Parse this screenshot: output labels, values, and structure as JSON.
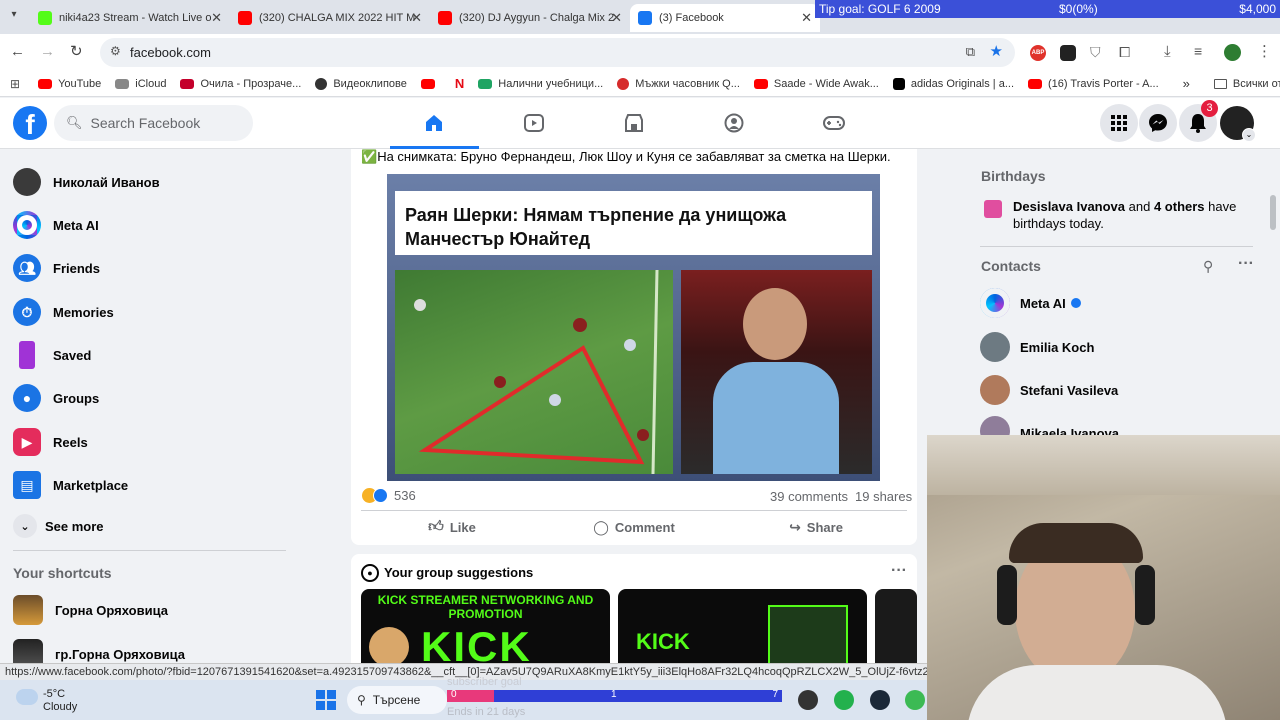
{
  "browser": {
    "tabs": [
      {
        "title": "niki4a23 Stream - Watch Live o",
        "icon": "kick-icon",
        "color": "#53fc18"
      },
      {
        "title": "(320) CHALGA MIX 2022 HIT M",
        "icon": "youtube-icon",
        "color": "#ff0000"
      },
      {
        "title": "(320) DJ Aygyun - Chalga Mix 2",
        "icon": "youtube-icon",
        "color": "#ff0000"
      },
      {
        "title": "(3) Facebook",
        "icon": "facebook-icon",
        "color": "#1877f2"
      }
    ],
    "url": "facebook.com",
    "bookmarks": [
      {
        "label": "YouTube",
        "color": "#ff0000"
      },
      {
        "label": "iCloud",
        "color": "#888888"
      },
      {
        "label": "Очила - Прозраче...",
        "color": "#c4002b"
      },
      {
        "label": "Видеоклипове",
        "color": "#333333"
      },
      {
        "label": "",
        "color": "#ff0000"
      },
      {
        "label": "",
        "color": "#e50914"
      },
      {
        "label": "Налични учебници...",
        "color": "#1fa463"
      },
      {
        "label": "Мъжки часовник Q...",
        "color": "#d62b2b"
      },
      {
        "label": "Saade - Wide Awak...",
        "color": "#ff0000"
      },
      {
        "label": "adidas Originals | a...",
        "color": "#000000"
      },
      {
        "label": "(16) Travis Porter - A...",
        "color": "#ff0000"
      }
    ],
    "bookmarks_more": "»",
    "bookmarks_folder": "Всички отметки",
    "extension_badge": "ABP"
  },
  "fb": {
    "search_placeholder": "Search Facebook",
    "notif_count": "3",
    "left_nav": [
      {
        "label": "Николай Иванов",
        "icon": "profile-avatar"
      },
      {
        "label": "Meta AI",
        "icon": "meta-ai-icon"
      },
      {
        "label": "Friends",
        "icon": "friends-icon"
      },
      {
        "label": "Memories",
        "icon": "memories-icon"
      },
      {
        "label": "Saved",
        "icon": "saved-icon"
      },
      {
        "label": "Groups",
        "icon": "groups-icon"
      },
      {
        "label": "Reels",
        "icon": "reels-icon"
      },
      {
        "label": "Marketplace",
        "icon": "marketplace-icon"
      }
    ],
    "see_more": "See more",
    "shortcuts_title": "Your shortcuts",
    "shortcuts": [
      "Горна Оряховица",
      "гр.Горна Оряховица"
    ],
    "post": {
      "caption_check": "✅",
      "caption": "На снимката: Бруно Фернандеш, Люк Шоу и Куня се забавляват за сметка на Шерки.",
      "headline": "Раян Шерки: Нямам търпение да унищожа Манчестър Юнайтед",
      "reactions_count": "536",
      "comments": "39 comments",
      "shares": "19 shares",
      "like": "Like",
      "comment": "Comment",
      "share": "Share"
    },
    "group_suggestions": {
      "title": "Your group suggestions",
      "card1_title": "KICK STREAMER NETWORKING AND PROMOTION",
      "card1_big": "KICK",
      "card2_big": "KICK"
    },
    "right": {
      "birthdays_title": "Birthdays",
      "birthday_name": "Desislava Ivanova",
      "birthday_mid": " and ",
      "birthday_others": "4 others",
      "birthday_tail": " have birthdays today.",
      "contacts_title": "Contacts",
      "contacts": [
        "Meta AI",
        "Emilia Koch",
        "Stefani Vasileva",
        "Mikaela Ivanova"
      ]
    }
  },
  "overlay": {
    "tip_goal": "Tip goal: GOLF 6 2009",
    "tip_progress": "$0(0%)",
    "tip_target": "$4,000",
    "status_url": "https://www.facebook.com/photo/?fbid=1207671391541620&set=a.492315709743862&__cft__[0]=AZav5U7Q9ARuXA8KmyE1ktY5y_iii3ElqHo8AFr32LQ4hcoqQpRZLCX2W_5_OlUjZ-f6vtz2xo2igxuKCogEm_qlhnu",
    "subscriber_goal": "subscriber goal",
    "sub_start": "0",
    "sub_mid": "1",
    "sub_end": "7",
    "sub_progress": 0.14,
    "ends_in": "Ends in 21 days"
  },
  "taskbar": {
    "weather_temp": "-5°C",
    "weather_desc": "Cloudy",
    "search": "Търсене"
  }
}
